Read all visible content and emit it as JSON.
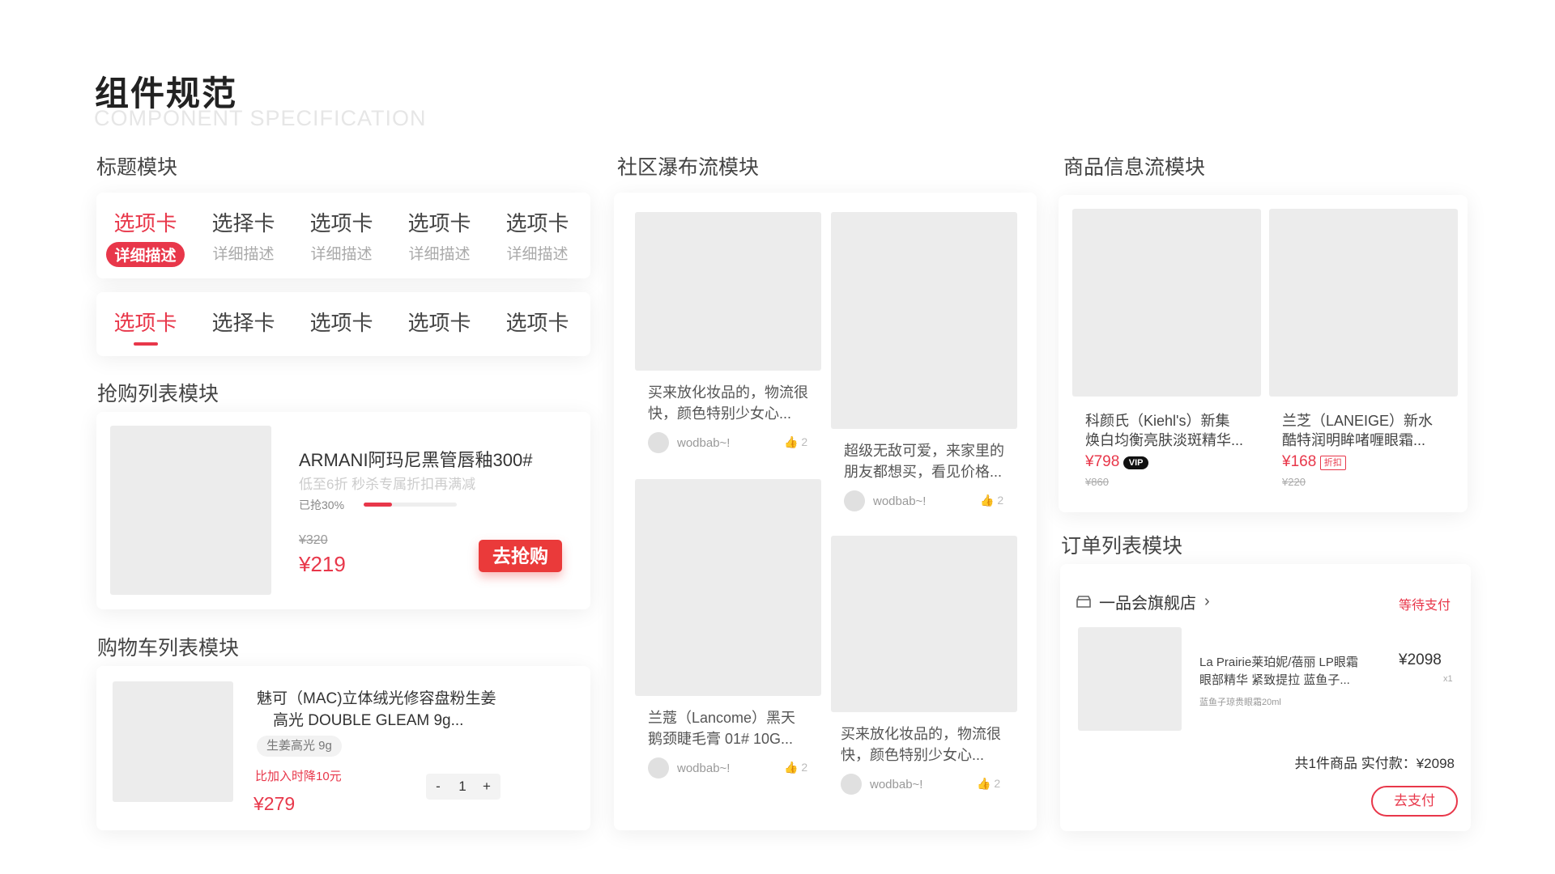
{
  "page": {
    "title": "组件规范",
    "subtitle": "COMPONENT SPECIFICATION"
  },
  "sections": {
    "title_module": "标题模块",
    "flash_sale": "抢购列表模块",
    "cart": "购物车列表模块",
    "waterfall": "社区瀑布流模块",
    "product_feed": "商品信息流模块",
    "order": "订单列表模块"
  },
  "tabs_a": [
    {
      "label": "选项卡",
      "desc": "详细描述"
    },
    {
      "label": "选择卡",
      "desc": "详细描述"
    },
    {
      "label": "选项卡",
      "desc": "详细描述"
    },
    {
      "label": "选项卡",
      "desc": "详细描述"
    },
    {
      "label": "选项卡",
      "desc": "详细描述"
    }
  ],
  "tabs_b": [
    {
      "label": "选项卡"
    },
    {
      "label": "选择卡"
    },
    {
      "label": "选项卡"
    },
    {
      "label": "选项卡"
    },
    {
      "label": "选项卡"
    }
  ],
  "flash": {
    "name": "ARMANI阿玛尼黑管唇釉300#",
    "desc": "低至6折 秒杀专属折扣再满减",
    "sold": "已抢30%",
    "progress": 0.3,
    "old_price": "¥320",
    "price": "¥219",
    "button": "去抢购"
  },
  "cart": {
    "name_line1": "魅可（MAC)立体绒光修容盘粉生姜",
    "name_line2": "高光 DOUBLE GLEAM 9g...",
    "spec": "生姜高光 9g",
    "drop": "比加入时降10元",
    "price": "¥279",
    "minus": "-",
    "qty": "1",
    "plus": "+"
  },
  "waterfall": {
    "cards": [
      {
        "text1": "买来放化妆品的，物流很",
        "text2": "快，颜色特别少女心...",
        "user": "wodbab~!",
        "likes": "2"
      },
      {
        "text1": "兰蔻（Lancome）黑天",
        "text2": "鹅颈睫毛膏 01# 10G...",
        "user": "wodbab~!",
        "likes": "2"
      },
      {
        "text1": "超级无敌可爱，来家里的",
        "text2": "朋友都想买，看见价格...",
        "user": "wodbab~!",
        "likes": "2"
      },
      {
        "text1": "买来放化妆品的，物流很",
        "text2": "快，颜色特别少女心...",
        "user": "wodbab~!",
        "likes": "2"
      }
    ]
  },
  "products": [
    {
      "line1": "科颜氏（Kiehl's）新集",
      "line2": "焕白均衡亮肤淡斑精华...",
      "price": "¥798",
      "badge": "VIP",
      "old": "¥860"
    },
    {
      "line1": "兰芝（LANEIGE）新水",
      "line2": "酷特润明眸啫喱眼霜...",
      "price": "¥168",
      "badge": "折扣",
      "old": "¥220"
    }
  ],
  "order": {
    "shop": "一品会旗舰店",
    "status": "等待支付",
    "item_line1": "La Prairie莱珀妮/蓓丽 LP眼霜",
    "item_line2": "眼部精华 紧致提拉 蓝鱼子...",
    "spec": "蓝鱼子琼贵眼霜20ml",
    "price": "¥2098",
    "qty": "x1",
    "summary": "共1件商品 实付款：¥2098",
    "button": "去支付"
  },
  "colors": {
    "accent": "#e8374a",
    "placeholder": "#ececec"
  }
}
